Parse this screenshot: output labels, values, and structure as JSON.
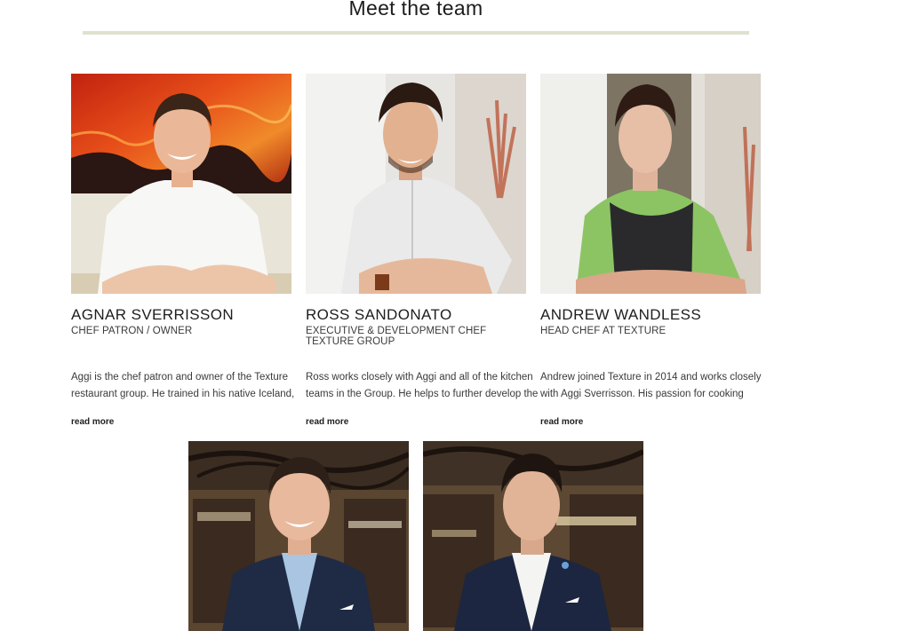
{
  "section": {
    "title": "Meet the team"
  },
  "team": [
    {
      "name": "AGNAR SVERRISSON",
      "role": "CHEF PATRON / OWNER",
      "bio": "Aggi is the chef patron and owner of the Texture restaurant group. He trained in his native Iceland,",
      "read_more": "read more",
      "photo_icon": "chef-portrait-icon"
    },
    {
      "name": "ROSS SANDONATO",
      "role": "EXECUTIVE & DEVELOPMENT CHEF TEXTURE GROUP",
      "bio": "Ross works closely with Aggi and all of the kitchen teams in the Group. He helps to further develop the",
      "read_more": "read more",
      "photo_icon": "chef-portrait-icon"
    },
    {
      "name": "ANDREW WANDLESS",
      "role": "HEAD CHEF AT TEXTURE",
      "bio": "Andrew joined Texture in 2014 and works closely with Aggi Sverrisson. His passion for cooking",
      "read_more": "read more",
      "photo_icon": "chef-portrait-icon"
    },
    {
      "photo_icon": "sommelier-portrait-icon"
    },
    {
      "photo_icon": "sommelier-portrait-icon"
    }
  ],
  "colors": {
    "title_rule": "#e0e0cf",
    "text": "#3a3a3a",
    "heading": "#1e1e1e"
  }
}
